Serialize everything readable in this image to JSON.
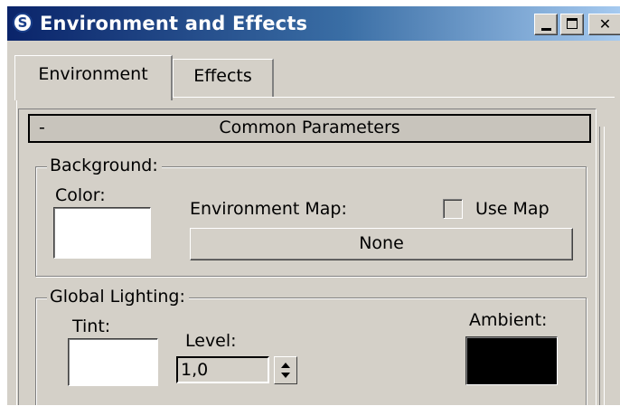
{
  "window": {
    "title": "Environment and Effects",
    "app_icon": "3dsmax-logo-icon",
    "app_icon_glyph": "S",
    "controls": {
      "minimize": "minimize-icon",
      "maximize": "maximize-icon",
      "close": "✕"
    }
  },
  "tabs": [
    {
      "label": "Environment",
      "active": true
    },
    {
      "label": "Effects",
      "active": false
    }
  ],
  "rollout": {
    "toggle": "-",
    "title": "Common Parameters"
  },
  "background": {
    "legend": "Background:",
    "color_label": "Color:",
    "color_value": "#ffffff",
    "env_map_label": "Environment Map:",
    "use_map_label": "Use Map",
    "use_map_checked": false,
    "map_button": "None"
  },
  "global_lighting": {
    "legend": "Global Lighting:",
    "tint_label": "Tint:",
    "tint_value": "#ffffff",
    "level_label": "Level:",
    "level_value": "1,0",
    "ambient_label": "Ambient:",
    "ambient_value": "#000000"
  }
}
